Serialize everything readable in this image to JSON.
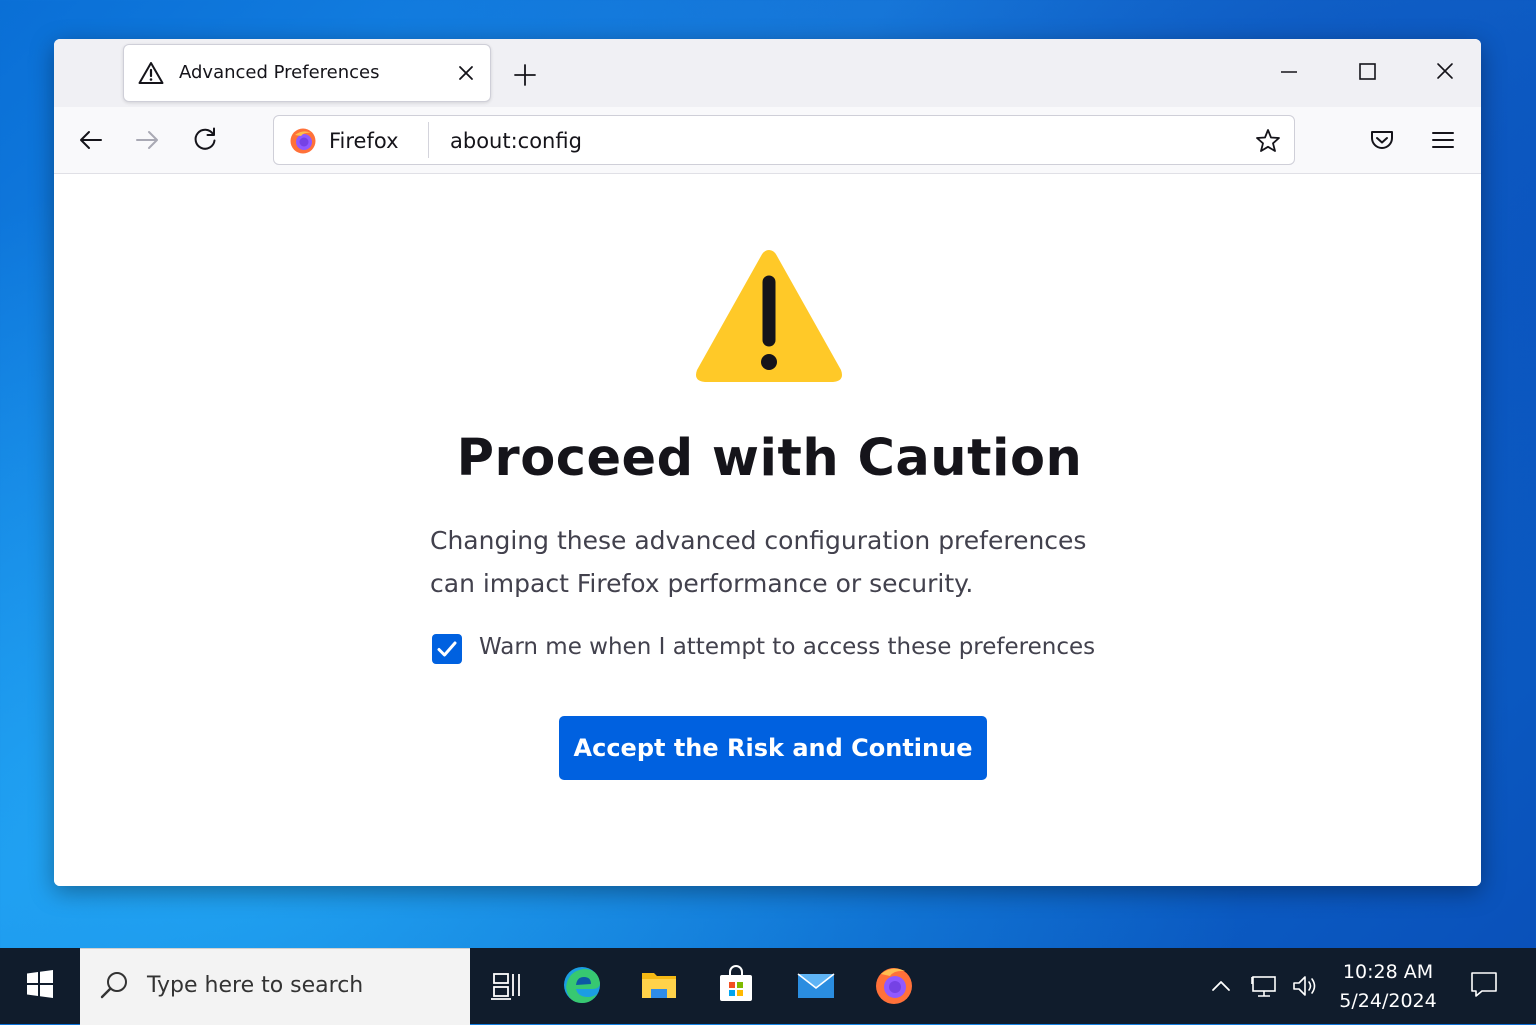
{
  "browser": {
    "tab": {
      "title": "Advanced Preferences"
    },
    "urlbar": {
      "identity": "Firefox",
      "url": "about:config"
    }
  },
  "page": {
    "headline": "Proceed with Caution",
    "description": "Changing these advanced configuration preferences can impact Firefox performance or security.",
    "checkbox": {
      "label": "Warn me when I attempt to access these preferences",
      "checked": true
    },
    "accept_button": "Accept the Risk and Continue"
  },
  "taskbar": {
    "search_placeholder": "Type here to search",
    "pinned": [
      "task-view-icon",
      "edge-icon",
      "file-explorer-icon",
      "store-icon",
      "mail-icon",
      "firefox-icon"
    ],
    "clock": {
      "time": "10:28 AM",
      "date": "5/24/2024"
    }
  },
  "colors": {
    "accent": "#0061e0",
    "warning": "#ffc928",
    "taskbar": "#101c2c",
    "desktop": "#0a6fd6"
  }
}
